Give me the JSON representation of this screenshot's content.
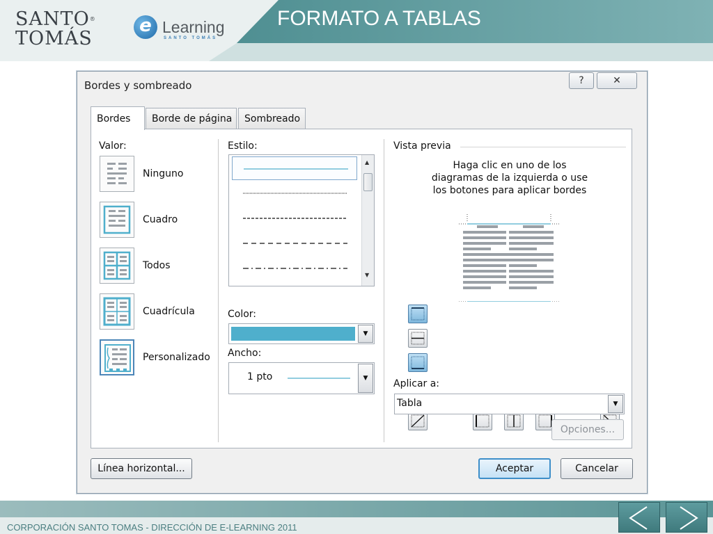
{
  "slide": {
    "title": "FORMATO A TABLAS",
    "logo_santo": "SANTO",
    "logo_tomas": "TOMÁS",
    "elearning_logo_text": "Learning",
    "elearning_logo_sub": "SANTO TOMÁS",
    "footer_text": "CORPORACIÓN SANTO TOMAS - DIRECCIÓN DE E-LEARNING  2011",
    "colors": {
      "teal": "#4f8f92",
      "accent_blue": "#4fafcc"
    }
  },
  "dialog": {
    "title": "Bordes y sombreado",
    "help_label": "?",
    "close_label": "✕",
    "tabs": [
      {
        "label": "Bordes",
        "active": true
      },
      {
        "label": "Borde de página",
        "active": false
      },
      {
        "label": "Sombreado",
        "active": false
      }
    ],
    "valor": {
      "label": "Valor:",
      "settings": [
        {
          "label": "Ninguno",
          "icon": "border-none-icon"
        },
        {
          "label": "Cuadro",
          "icon": "border-box-icon"
        },
        {
          "label": "Todos",
          "icon": "border-all-icon"
        },
        {
          "label": "Cuadrícula",
          "icon": "border-grid-icon"
        },
        {
          "label": "Personalizado",
          "icon": "border-custom-icon"
        }
      ]
    },
    "estilo": {
      "label": "Estilo:",
      "styles": [
        "solid",
        "dotted",
        "dashed-fine",
        "dashed",
        "dash-dot"
      ],
      "selected_index": 0
    },
    "color": {
      "label": "Color:",
      "value": "#4fafcc"
    },
    "ancho": {
      "label": "Ancho:",
      "value": "1 pto"
    },
    "vista_previa": {
      "label": "Vista previa",
      "instructions_1": "Haga clic en uno de los",
      "instructions_2": "diagramas de la izquierda o use",
      "instructions_3": "los botones para aplicar bordes"
    },
    "aplicar": {
      "label": "Aplicar a:",
      "value": "Tabla"
    },
    "opciones_label": "Opciones...",
    "linea_horizontal_label": "Línea horizontal...",
    "aceptar_label": "Aceptar",
    "cancelar_label": "Cancelar"
  }
}
